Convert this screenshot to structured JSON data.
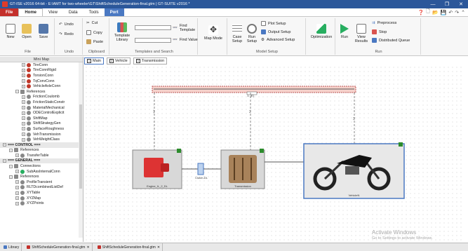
{
  "window": {
    "title": "GT-ISE v2016 64-bit - E:\\AMT for two-wheeler\\GT\\ShiftScheduleGeneration-final.gtm | GT-SUITE v2016 *",
    "buttons": [
      "—",
      "❐",
      "✕"
    ]
  },
  "menu": {
    "file": "File",
    "home": "Home",
    "view": "View",
    "data": "Data",
    "tools": "Tools",
    "port": "Port"
  },
  "ribbon": {
    "file_group": {
      "label": "File",
      "new": "New",
      "open": "Open",
      "save": "Save"
    },
    "undo_group": {
      "label": "Undo",
      "undo": "Undo",
      "redo": "Redo"
    },
    "clipboard_group": {
      "label": "Clipboard",
      "cut": "Cut",
      "copy": "Copy",
      "paste": "Paste"
    },
    "templates_group": {
      "label": "Templates and Search",
      "template_library": "Template Library",
      "find_template": "Find Template",
      "find_value": "Find Value"
    },
    "mapmode": "Map Mode",
    "model_group": {
      "label": "Model Setup",
      "case_setup": "Case Setup",
      "run_setup": "Run Setup",
      "plot_setup": "Plot Setup",
      "output_setup": "Output Setup",
      "advanced_setup": "Advanced Setup"
    },
    "optimization": "Optimization",
    "run_group": {
      "label": "Run",
      "run": "Run",
      "view_results": "View Results",
      "preprocess": "Preprocess",
      "stop": "Stop",
      "distributed_queue": "Distributed Queue"
    }
  },
  "sidebar": {
    "minimap": "Mini Map",
    "rows": [
      {
        "label": "TireConn",
        "level": 3,
        "type": "item",
        "color": "#c0392b"
      },
      {
        "label": "TireConnRigid",
        "level": 3,
        "type": "item",
        "color": "#c0392b"
      },
      {
        "label": "TorsionConn",
        "level": 3,
        "type": "item",
        "color": "#c0392b"
      },
      {
        "label": "TqConvConn",
        "level": 3,
        "type": "item",
        "color": "#c0392b"
      },
      {
        "label": "VehicleAxleConn",
        "level": 3,
        "type": "item",
        "color": "#c0392b"
      },
      {
        "label": "References",
        "level": 2,
        "type": "folder",
        "color": "#888888"
      },
      {
        "label": "FrictionCoulomb",
        "level": 3,
        "type": "item",
        "color": "#888888"
      },
      {
        "label": "FrictionStaticConstr",
        "level": 3,
        "type": "item",
        "color": "#888888"
      },
      {
        "label": "MaterialMechanical",
        "level": 3,
        "type": "item",
        "color": "#888888"
      },
      {
        "label": "ODEControlExplicit",
        "level": 3,
        "type": "item",
        "color": "#888888"
      },
      {
        "label": "ShiftMap",
        "level": 3,
        "type": "item",
        "color": "#888888"
      },
      {
        "label": "ShiftStrategyGen",
        "level": 3,
        "type": "item",
        "color": "#888888"
      },
      {
        "label": "SurfaceRoughness",
        "level": 3,
        "type": "item",
        "color": "#888888"
      },
      {
        "label": "VehTransmission",
        "level": 3,
        "type": "item",
        "color": "#888888"
      },
      {
        "label": "VehWeightClass",
        "level": 3,
        "type": "item",
        "color": "#888888"
      },
      {
        "label": "=== CONTROL ===",
        "level": 0,
        "type": "section",
        "color": ""
      },
      {
        "label": "References",
        "level": 1,
        "type": "folder",
        "color": "#888888"
      },
      {
        "label": "TransferTable",
        "level": 2,
        "type": "item",
        "color": "#888888"
      },
      {
        "label": "=== GENERAL ===",
        "level": 0,
        "type": "section",
        "color": ""
      },
      {
        "label": "Connections",
        "level": 1,
        "type": "folder",
        "color": "#888888"
      },
      {
        "label": "SubAssInternalConn",
        "level": 2,
        "type": "item",
        "color": "#27ae60"
      },
      {
        "label": "References",
        "level": 1,
        "type": "folder",
        "color": "#888888"
      },
      {
        "label": "ProfileTransient",
        "level": 2,
        "type": "item",
        "color": "#888888"
      },
      {
        "label": "RLTDcombinedListDef",
        "level": 2,
        "type": "item",
        "color": "#888888"
      },
      {
        "label": "XYTable",
        "level": 2,
        "type": "item",
        "color": "#888888"
      },
      {
        "label": "XYZMap",
        "level": 2,
        "type": "item",
        "color": "#888888"
      },
      {
        "label": "XYZPoints",
        "level": 2,
        "type": "item",
        "color": "#888888"
      }
    ]
  },
  "tabs": {
    "main": "Main",
    "vehicle": "Vehicle",
    "transmission": "Transmission"
  },
  "canvas": {
    "top_label": "1: [E]",
    "engine_label": "Engine_IL_2_DL",
    "clutch_label": "Clutch-DL",
    "transmission_label": "Transmission",
    "vehicle_label": "VehicleN",
    "watermark_title": "Activate Windows",
    "watermark_sub": "Go to Settings to activate Windows."
  },
  "statusbar": {
    "library": "Library",
    "file1": "ShiftScheduleGeneration-final.gtm",
    "file2": "ShiftScheduleGeneration-final.gtm"
  },
  "colors": {
    "accent": "#4a78c2",
    "file_tab": "#c4302b",
    "titlebar": "#2b579a"
  }
}
